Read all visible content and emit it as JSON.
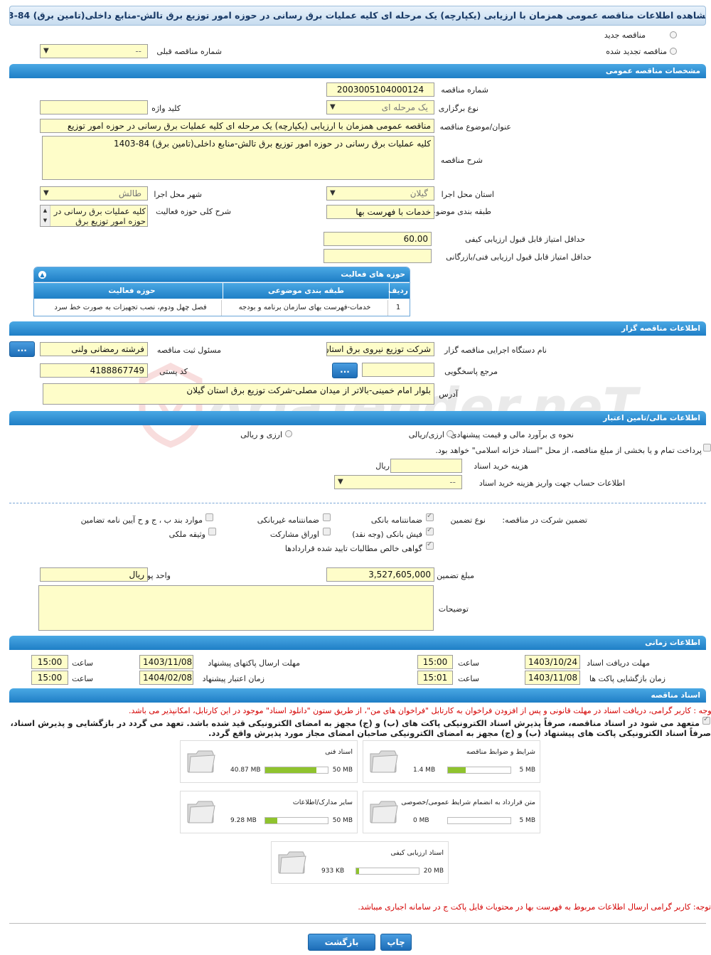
{
  "page_title": "مشاهده اطلاعات مناقصه عمومی همزمان با ارزیابی (یکپارچه) یک مرحله ای کلیه عملیات برق رسانی در حوزه امور توزیع برق تالش-منابع داخلی(تامین برق) 84-1403",
  "top": {
    "new_tender": "مناقصه جدید",
    "renewed_tender": "مناقصه تجدید شده",
    "prev_tender_label": "شماره مناقصه قبلی",
    "prev_tender_value": "--"
  },
  "general": {
    "header": "مشخصات مناقصه عمومی",
    "number_label": "شماره مناقصه",
    "number_value": "2003005104000124",
    "type_label": "نوع برگزاری",
    "type_value": "یک مرحله ای",
    "keyword_label": "کلید واژه",
    "keyword_value": "",
    "title_label": "عنوان/موضوع مناقصه",
    "title_value": "مناقصه عمومی همزمان با ارزیابی (یکپارچه) یک مرحله ای کلیه عملیات برق رسانی در حوزه امور توزیع",
    "desc_label": "شرح مناقصه",
    "desc_value": "کلیه عملیات برق رسانی در حوزه امور توزیع برق تالش-منابع داخلی(تامین برق) 84-1403",
    "province_label": "استان محل اجرا",
    "province_value": "گیلان",
    "city_label": "شهر محل اجرا",
    "city_value": "طالش",
    "category_label": "طبقه بندی موضوعی",
    "category_value": "خدمات با فهرست بها",
    "activity_desc_label": "شرح کلی حوزه فعالیت",
    "activity_desc_value": "کلیه عملیات برق رسانی در حوزه امور توزیع برق",
    "min_quality_label": "حداقل امتیاز قابل قبول ارزیابی کیفی",
    "min_quality_value": "60.00",
    "min_tech_label": "حداقل امتیاز قابل قبول ارزیابی فنی/بازرگانی",
    "min_tech_value": ""
  },
  "activity_table": {
    "title": "حوزه های فعالیت",
    "headers": [
      "ردیف",
      "طبقه بندی موضوعی",
      "حوزه فعالیت"
    ],
    "rows": [
      {
        "n": "1",
        "cat": "خدمات-فهرست بهای سازمان برنامه و بودجه",
        "field": "فصل چهل ودوم، نصب تجهیزات به صورت خط سرد"
      }
    ]
  },
  "organizer": {
    "header": "اطلاعات مناقصه گزار",
    "org_label": "نام دستگاه اجرایی مناقصه گزار",
    "org_value": "شرکت توزیع نیروی برق استان",
    "resp_label": "مسئول ثبت مناقصه",
    "resp_value": "فرشته رمضانی ولنی",
    "ref_label": "مرجع پاسخگویی",
    "ref_value": "",
    "postal_label": "کد پستی",
    "postal_value": "4188867749",
    "address_label": "آدرس",
    "address_value": "بلوار امام خمینی-بالاتر از میدان مصلی-شرکت توزیع برق استان گیلان",
    "btn": "..."
  },
  "finance": {
    "header": "اطلاعات مالی/تامین اعتبار",
    "estimate_label": "نحوه ی برآورد مالی و قیمت پیشنهادی",
    "opt_rial": "ارزی/ریالی",
    "opt_both": "ارزی و ریالی",
    "islamic_text": "پرداخت تمام و یا بخشی از مبلغ مناقصه، از محل \"اسناد خزانه اسلامی\" خواهد بود.",
    "doc_cost_label": "هزینه خرید اسناد",
    "doc_cost_unit": "ریال",
    "doc_cost_value": "",
    "account_label": "اطلاعات حساب جهت واریز هزینه خرید اسناد",
    "account_value": "--"
  },
  "guarantee": {
    "label": "تضمین شرکت در مناقصه:",
    "type_label": "نوع تضمین",
    "bank_guarantee": "ضمانتنامه بانکی",
    "nonbank_guarantee": "ضمانتنامه غیربانکی",
    "items_bcj": "موارد بند ب ، ج و ح آیین نامه تضامین",
    "bank_check": "فیش بانکی (وجه نقد)",
    "partnership": "اوراق مشارکت",
    "property": "وثیقه ملکی",
    "receivables": "گواهی خالص مطالبات تایید شده قراردادها",
    "amount_label": "مبلغ تضمین",
    "amount_value": "3,527,605,000",
    "currency_label": "واحد پول",
    "currency_value": "ریال",
    "notes_label": "توضیحات",
    "notes_value": ""
  },
  "timing": {
    "header": "اطلاعات زمانی",
    "doc_deadline_label": "مهلت دریافت اسناد",
    "doc_deadline_date": "1403/10/24",
    "doc_deadline_time": "15:00",
    "send_deadline_label": "مهلت ارسال پاکتهای پیشنهاد",
    "send_deadline_date": "1403/11/08",
    "send_deadline_time": "15:00",
    "open_label": "زمان بازگشایی پاکت ها",
    "open_date": "1403/11/08",
    "open_time": "15:01",
    "validity_label": "زمان اعتبار پیشنهاد",
    "validity_date": "1404/02/08",
    "validity_time": "15:00",
    "time_word": "ساعت"
  },
  "docs": {
    "header": "اسناد مناقصه",
    "note1": "توجه : کاربر گرامی، دریافت اسناد در مهلت قانونی و پس از افزودن فراخوان به کارتابل \"فراخوان های من\"، از طریق ستون \"دانلود اسناد\" موجود در این کارتابل، امکانپذیر می باشد.",
    "commit_line1": "متعهد می شود در اسناد مناقصه، صرفاً پذیرش اسناد الکترونیکی پاکت های (ب) و (ج) مجهز به امضای الکترونیکی قید شده باشد. تعهد می گردد در بازگشایی و پذیرش اسناد،",
    "commit_line2": "صرفاً اسناد الکترونیکی پاکت های پیشنهاد (ب) و (ج) مجهز به امضای الکترونیکی صاحبان امضای مجاز مورد پذیرش واقع گردد.",
    "files": [
      {
        "name": "شرایط و ضوابط مناقصه",
        "current": "1.4 MB",
        "max": "5 MB",
        "fill": 0.28
      },
      {
        "name": "اسناد فنی",
        "current": "40.87 MB",
        "max": "50 MB",
        "fill": 0.82
      },
      {
        "name": "متن قرارداد به انضمام شرایط عمومی/خصوصی",
        "current": "0 MB",
        "max": "5 MB",
        "fill": 0.0
      },
      {
        "name": "سایر مدارک/اطلاعات",
        "current": "9.28 MB",
        "max": "50 MB",
        "fill": 0.19
      },
      {
        "name": "اسناد ارزیابی کیفی",
        "current": "933 KB",
        "max": "20 MB",
        "fill": 0.05
      }
    ],
    "note2": "توجه: کاربر گرامی ارسال اطلاعات مربوط به فهرست بها در محتویات فایل پاکت ج در سامانه اجباری میباشد."
  },
  "buttons": {
    "print": "چاپ",
    "back": "بازگشت"
  },
  "watermark": "AriaTender.neT",
  "colors": {
    "bar": "#2a8cd2",
    "input_bg": "#fefdc9",
    "red_note": "#d40000",
    "progress": "#8fc32e"
  }
}
